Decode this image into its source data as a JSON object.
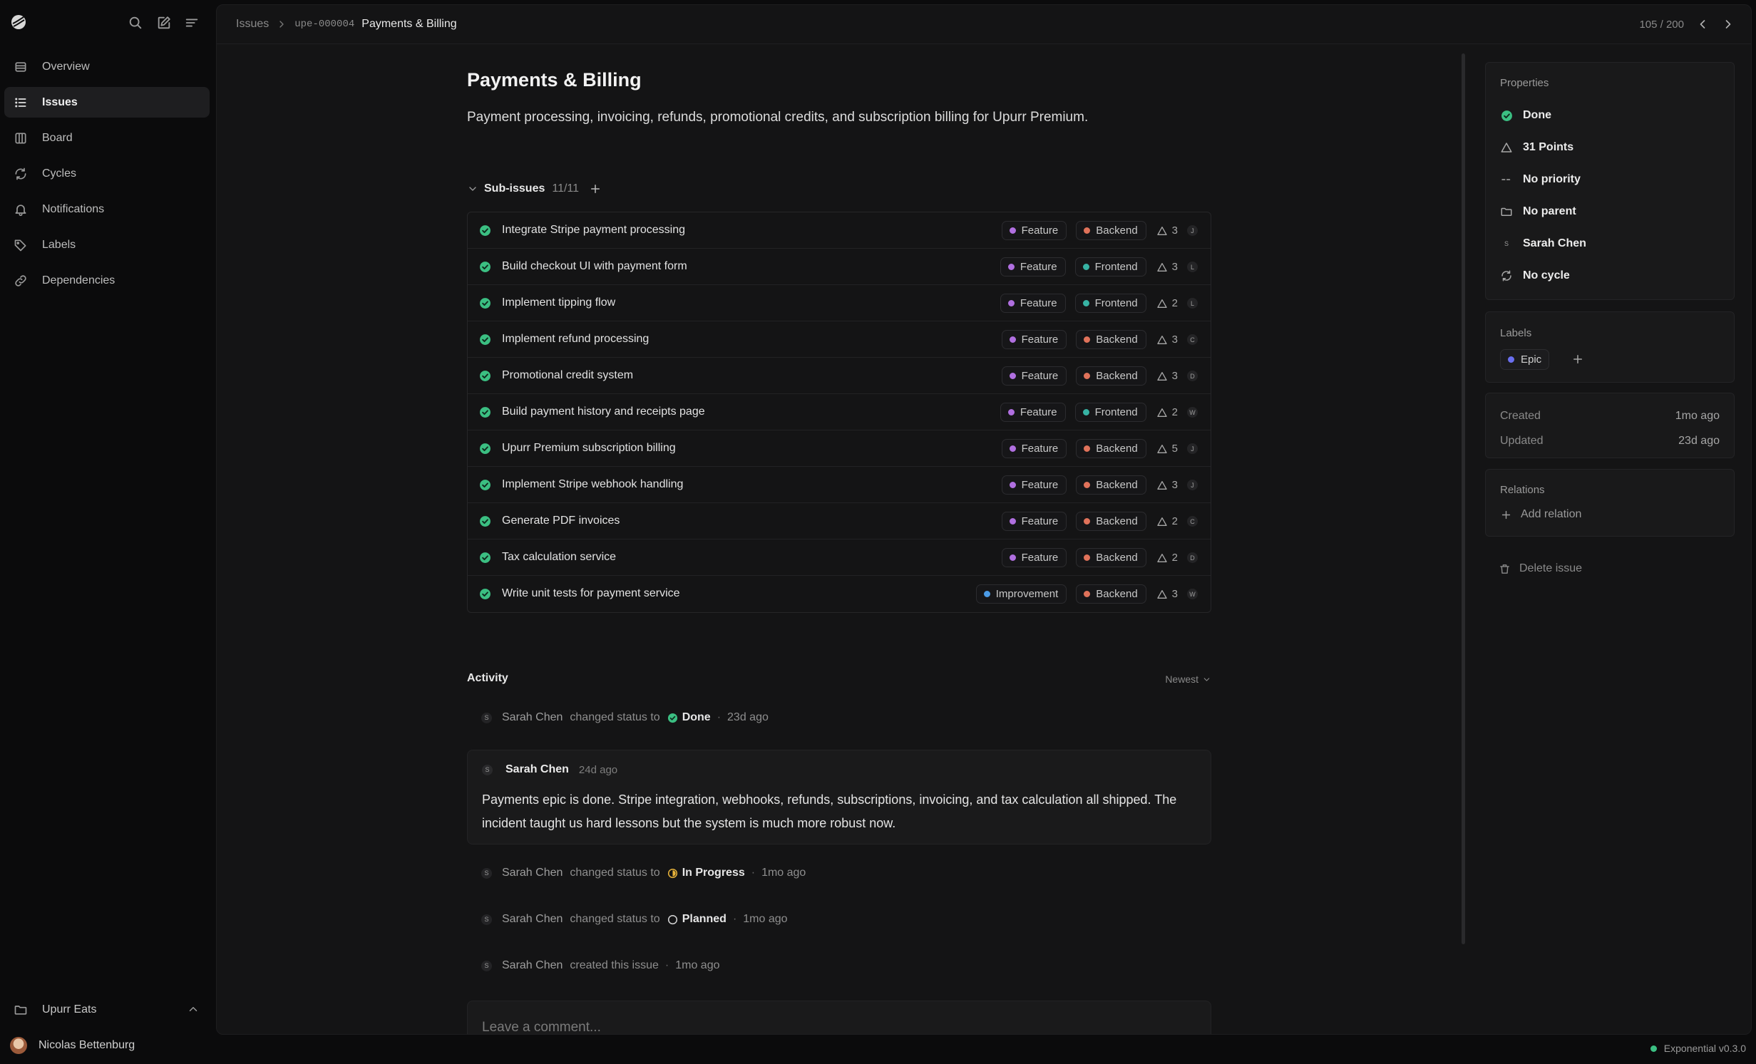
{
  "colors": {
    "done_green": "#3bbf82",
    "feature_purple": "#b06fe0",
    "backend_orange": "#e0725a",
    "frontend_teal": "#37b3a4",
    "improvement_blue": "#4b9be6",
    "epic_indigo": "#6a6ff0",
    "in_progress_yellow": "#e8b33a"
  },
  "app": {
    "name": "Exponential",
    "version": "Exponential v0.3.0"
  },
  "sidebar": {
    "tools": {
      "search_icon": "search-icon",
      "compose_icon": "compose-icon",
      "menu_icon": "menu-icon"
    },
    "items": [
      {
        "label": "Overview",
        "icon": "list-icon"
      },
      {
        "label": "Issues",
        "icon": "issues-icon",
        "active": true
      },
      {
        "label": "Board",
        "icon": "board-icon"
      },
      {
        "label": "Cycles",
        "icon": "cycle-icon"
      },
      {
        "label": "Notifications",
        "icon": "bell-icon"
      },
      {
        "label": "Labels",
        "icon": "tag-icon"
      },
      {
        "label": "Dependencies",
        "icon": "link-icon"
      }
    ],
    "workspace": "Upurr Eats",
    "user": "Nicolas Bettenburg"
  },
  "header": {
    "breadcrumb_root": "Issues",
    "issue_id": "upe-000004",
    "issue_title": "Payments & Billing",
    "pager": "105 / 200"
  },
  "issue": {
    "title": "Payments & Billing",
    "description": "Payment processing, invoicing, refunds, promotional credits, and subscription billing for Upurr Premium."
  },
  "sub_issues": {
    "label": "Sub-issues",
    "count": "11/11",
    "items": [
      {
        "title": "Integrate Stripe payment processing",
        "type": "Feature",
        "area": "Backend",
        "points": "3",
        "assignee": "J"
      },
      {
        "title": "Build checkout UI with payment form",
        "type": "Feature",
        "area": "Frontend",
        "points": "3",
        "assignee": "L"
      },
      {
        "title": "Implement tipping flow",
        "type": "Feature",
        "area": "Frontend",
        "points": "2",
        "assignee": "L"
      },
      {
        "title": "Implement refund processing",
        "type": "Feature",
        "area": "Backend",
        "points": "3",
        "assignee": "C"
      },
      {
        "title": "Promotional credit system",
        "type": "Feature",
        "area": "Backend",
        "points": "3",
        "assignee": "D"
      },
      {
        "title": "Build payment history and receipts page",
        "type": "Feature",
        "area": "Frontend",
        "points": "2",
        "assignee": "W"
      },
      {
        "title": "Upurr Premium subscription billing",
        "type": "Feature",
        "area": "Backend",
        "points": "5",
        "assignee": "J"
      },
      {
        "title": "Implement Stripe webhook handling",
        "type": "Feature",
        "area": "Backend",
        "points": "3",
        "assignee": "J"
      },
      {
        "title": "Generate PDF invoices",
        "type": "Feature",
        "area": "Backend",
        "points": "2",
        "assignee": "C"
      },
      {
        "title": "Tax calculation service",
        "type": "Feature",
        "area": "Backend",
        "points": "2",
        "assignee": "D"
      },
      {
        "title": "Write unit tests for payment service",
        "type": "Improvement",
        "area": "Backend",
        "points": "3",
        "assignee": "W"
      }
    ]
  },
  "activity": {
    "label": "Activity",
    "sort": "Newest",
    "events": [
      {
        "avatar": "S",
        "who": "Sarah Chen",
        "action": "changed status to",
        "status": "Done",
        "time": "23d ago"
      },
      {
        "avatar": "S",
        "who": "Sarah Chen",
        "action": "changed status to",
        "status": "In Progress",
        "time": "1mo ago"
      },
      {
        "avatar": "S",
        "who": "Sarah Chen",
        "action": "changed status to",
        "status": "Planned",
        "time": "1mo ago"
      },
      {
        "avatar": "S",
        "who": "Sarah Chen",
        "action": "created this issue",
        "time": "1mo ago"
      }
    ],
    "comment": {
      "avatar": "S",
      "author": "Sarah Chen",
      "time": "24d ago",
      "body": "Payments epic is done. Stripe integration, webhooks, refunds, subscriptions, invoicing, and tax calculation all shipped. The incident taught us hard lessons but the system is much more robust now."
    },
    "comment_placeholder": "Leave a comment..."
  },
  "properties": {
    "title": "Properties",
    "status": "Done",
    "points": "31 Points",
    "priority": "No priority",
    "parent": "No parent",
    "assignee_avatar": "S",
    "assignee": "Sarah Chen",
    "cycle": "No cycle"
  },
  "labels": {
    "title": "Labels",
    "items": [
      "Epic"
    ]
  },
  "dates": {
    "created_label": "Created",
    "created": "1mo ago",
    "updated_label": "Updated",
    "updated": "23d ago"
  },
  "relations": {
    "title": "Relations",
    "add": "Add relation"
  },
  "delete_label": "Delete issue"
}
